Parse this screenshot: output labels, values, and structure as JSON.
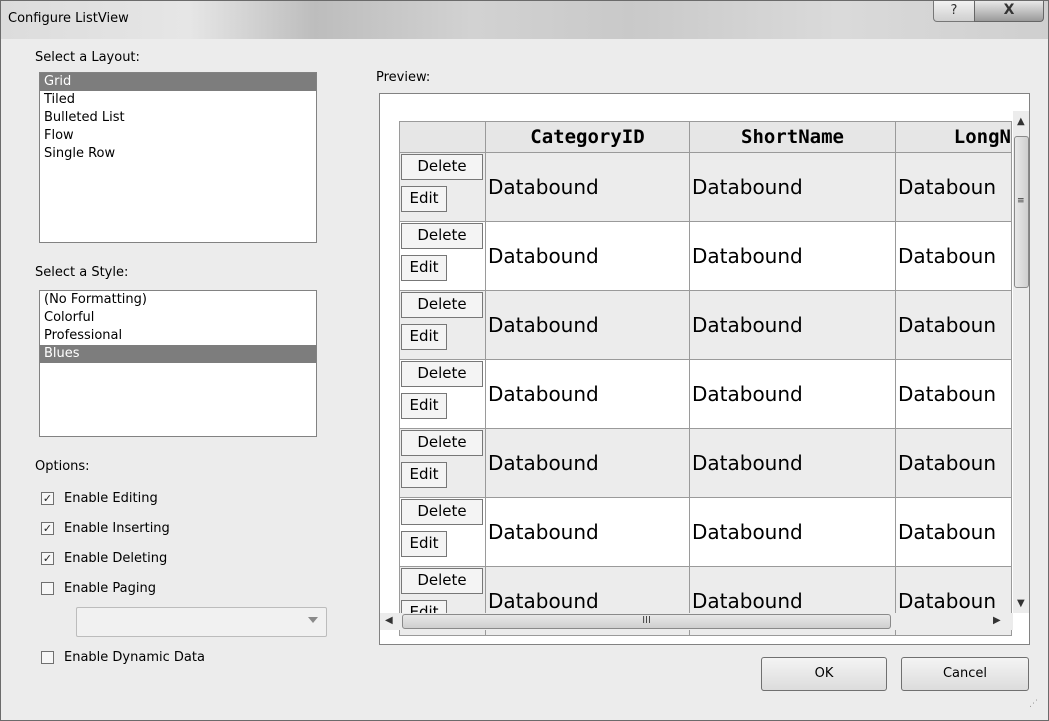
{
  "window": {
    "title": "Configure ListView",
    "help_glyph": "?",
    "close_glyph": "X"
  },
  "layout": {
    "label": "Select a Layout:",
    "items": [
      "Grid",
      "Tiled",
      "Bulleted List",
      "Flow",
      "Single Row"
    ],
    "selected": "Grid"
  },
  "style": {
    "label": "Select a Style:",
    "items": [
      "(No Formatting)",
      "Colorful",
      "Professional",
      "Blues"
    ],
    "selected": "Blues"
  },
  "options": {
    "label": "Options:",
    "checkboxes": [
      {
        "label": "Enable Editing",
        "checked": true
      },
      {
        "label": "Enable Inserting",
        "checked": true
      },
      {
        "label": "Enable Deleting",
        "checked": true
      },
      {
        "label": "Enable Paging",
        "checked": false
      }
    ],
    "paging_combo_value": "",
    "dynamic_data": {
      "label": "Enable Dynamic Data",
      "checked": false
    }
  },
  "preview": {
    "label": "Preview:",
    "columns": [
      "",
      "CategoryID",
      "ShortName",
      "LongN"
    ],
    "row_count": 7,
    "cell_text": "Databound",
    "truncated_cell_text": "Databoun",
    "delete_label": "Delete",
    "edit_label": "Edit",
    "hscroll_grip": "III"
  },
  "buttons": {
    "ok": "OK",
    "cancel": "Cancel"
  }
}
